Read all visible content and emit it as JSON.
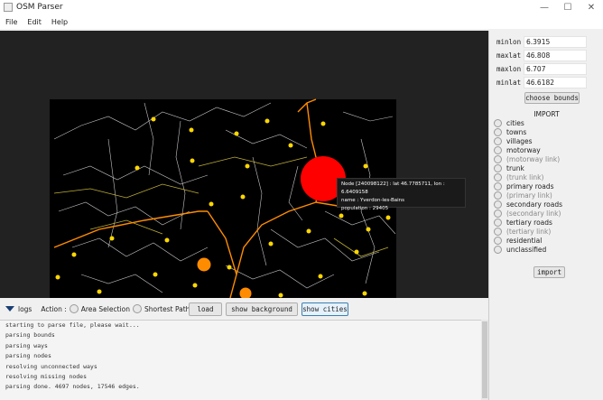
{
  "window": {
    "title": "OSM Parser"
  },
  "menu": [
    "File",
    "Edit",
    "Help"
  ],
  "bounds": [
    {
      "label": "minlon",
      "value": "6.3915"
    },
    {
      "label": "maxlat",
      "value": "46.808"
    },
    {
      "label": "maxlon",
      "value": "6.707"
    },
    {
      "label": "minlat",
      "value": "46.6182"
    }
  ],
  "choose_bounds_label": "choose bounds",
  "import_title": "IMPORT",
  "import_options": [
    {
      "label": "cities",
      "dim": false
    },
    {
      "label": "towns",
      "dim": false
    },
    {
      "label": "villages",
      "dim": false
    },
    {
      "label": "motorway",
      "dim": false
    },
    {
      "label": "(motorway link)",
      "dim": true
    },
    {
      "label": "trunk",
      "dim": false
    },
    {
      "label": "(trunk link)",
      "dim": true
    },
    {
      "label": "primary roads",
      "dim": false
    },
    {
      "label": "(primary link)",
      "dim": true
    },
    {
      "label": "secondary roads",
      "dim": false
    },
    {
      "label": "(secondary link)",
      "dim": true
    },
    {
      "label": "tertiary roads",
      "dim": false
    },
    {
      "label": "(tertiary link)",
      "dim": true
    },
    {
      "label": "residential",
      "dim": false
    },
    {
      "label": "unclassified",
      "dim": false
    }
  ],
  "import_button_label": "import",
  "toolbar": {
    "logs_label": "logs",
    "action_label": "Action :",
    "area_selection": "Area Selection",
    "shortest_paths": "Shortest Paths",
    "load": "load",
    "show_background": "show background",
    "show_cities": "show cities"
  },
  "tooltip": {
    "line1": "Node [240098122] : lat 46.7785711, lon : 6.6409158",
    "line2": "name : Yverdon-les-Bains",
    "line3": "population : 29405"
  },
  "logs": [
    "starting to parse file, please wait...",
    "parsing bounds",
    "parsing ways",
    "parsing nodes",
    "resolving unconnected ways",
    "resolving missing nodes",
    "parsing done. 4697 nodes, 17546 edges."
  ],
  "colors": {
    "map_bg": "#000000",
    "canvas_bg": "#222222",
    "city_major": "#ff0000",
    "town": "#ff8c00",
    "village": "#ffd700",
    "road_primary": "#ff8c00",
    "road_residential": "#ffffff",
    "accent": "#1a3e73"
  }
}
